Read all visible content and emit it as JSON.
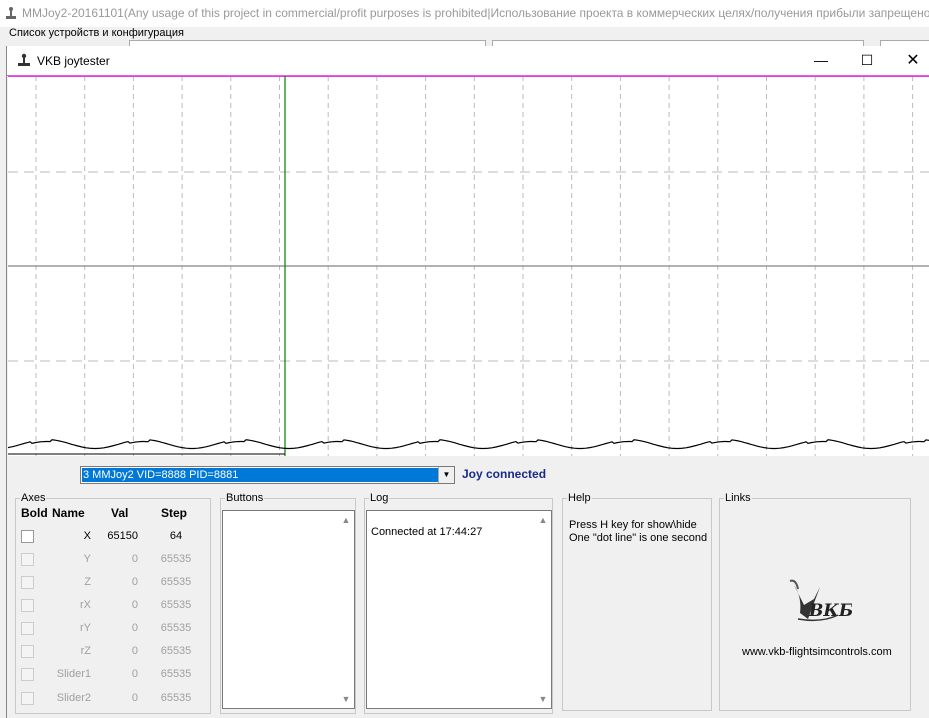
{
  "background_app": {
    "title": "MMJoy2-20161101(Any usage of this project in commercial/profit purposes is prohibited|Использование проекта в коммерческих целях/получения прибыли запрещено)",
    "subtitle": "Список устройств и конфигурация"
  },
  "window": {
    "title": "VKB joytester",
    "minimize_icon": "minimize-icon",
    "maximize_icon": "maximize-icon",
    "close_icon": "close-icon"
  },
  "plot": {
    "colors": {
      "cursor": "#008000",
      "top_line": "#e040e0",
      "grid": "#bbbbbb",
      "trace": "#000000"
    }
  },
  "device": {
    "selected": "3 MMJoy2 VID=8888 PID=8881",
    "status": "Joy connected"
  },
  "axes": {
    "label": "Axes",
    "headers": {
      "bold": "Bold",
      "name": "Name",
      "val": "Val",
      "step": "Step"
    },
    "rows": [
      {
        "name": "X",
        "val": "65150",
        "step": "64",
        "enabled": true
      },
      {
        "name": "Y",
        "val": "0",
        "step": "65535",
        "enabled": false
      },
      {
        "name": "Z",
        "val": "0",
        "step": "65535",
        "enabled": false
      },
      {
        "name": "rX",
        "val": "0",
        "step": "65535",
        "enabled": false
      },
      {
        "name": "rY",
        "val": "0",
        "step": "65535",
        "enabled": false
      },
      {
        "name": "rZ",
        "val": "0",
        "step": "65535",
        "enabled": false
      },
      {
        "name": "Slider1",
        "val": "0",
        "step": "65535",
        "enabled": false
      },
      {
        "name": "Slider2",
        "val": "0",
        "step": "65535",
        "enabled": false
      }
    ]
  },
  "buttons": {
    "label": "Buttons"
  },
  "log": {
    "label": "Log",
    "lines": [
      "Connected at 17:44:27"
    ]
  },
  "help": {
    "label": "Help",
    "line1": "Press H key for show\\hide",
    "line2": "One \"dot line\" is one second"
  },
  "links": {
    "label": "Links",
    "logo_text": "ВКБ",
    "url": "www.vkb-flightsimcontrols.com"
  }
}
